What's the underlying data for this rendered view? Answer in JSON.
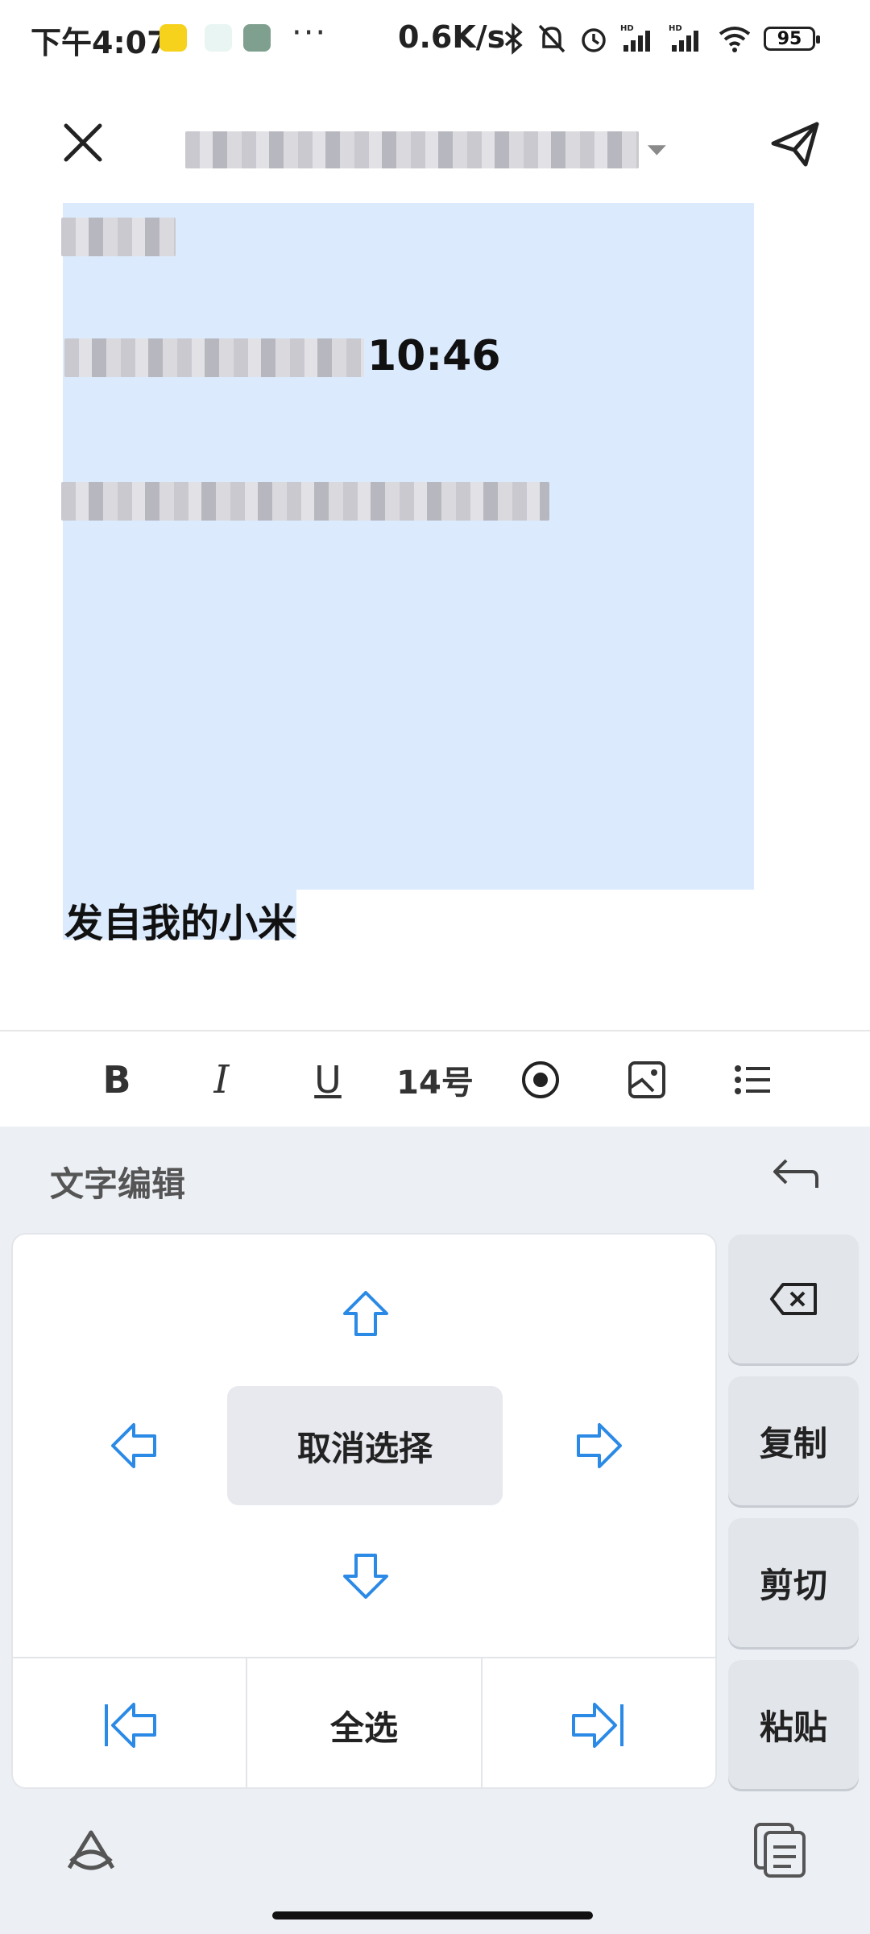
{
  "status_bar": {
    "time": "下午4:07",
    "dots": "···",
    "net_speed": "0.6K/s",
    "battery": "95",
    "icons": [
      "bluetooth-icon",
      "mute-bell-icon",
      "alarm-icon",
      "hd-signal-icon",
      "hd-signal-icon",
      "wifi-icon",
      "battery-icon"
    ]
  },
  "header": {
    "close_icon": "close-icon",
    "recipient_dropdown_icon": "caret-down-icon",
    "send_icon": "send-icon"
  },
  "message": {
    "time": "10:46",
    "signature": "发自我的小米"
  },
  "format_toolbar": {
    "bold": "B",
    "italic": "I",
    "underline": "U",
    "font_size": "14号",
    "icons": [
      "record-icon",
      "image-icon",
      "list-icon"
    ]
  },
  "text_edit_panel": {
    "title": "文字编辑",
    "deselect": "取消选择",
    "select_all": "全选",
    "delete_icon": "backspace-icon",
    "copy": "复制",
    "cut": "剪切",
    "paste": "粘贴"
  },
  "colors": {
    "accent": "#2b8ae6",
    "selection": "#dbeafd",
    "panel_bg": "#eceff4"
  }
}
